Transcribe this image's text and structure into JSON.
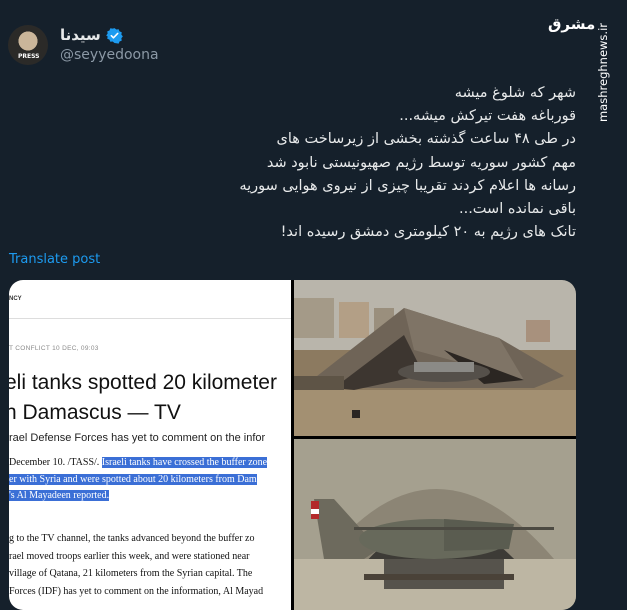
{
  "author": {
    "display_name": "سیدنا",
    "handle": "@seyyedoona",
    "avatar_badge": "PRESS"
  },
  "watermark": {
    "logo_text": "مشرق",
    "site": "mashreghnews.ir"
  },
  "tweet": {
    "text": "شهر که شلوغ میشه\nقورباغه هفت تیرکش میشه...\nدر طی ۴۸ ساعت گذشته بخشی از زیرساخت های\nمهم کشور سوریه توسط رژیم صهیونیستی نابود شد\nرسانه ها اعلام کردند تقریبا چیزی از نیروی هوایی سوریه\nباقی نمانده است...\nتانک های رژیم به ۲۰ کیلومتری دمشق رسیده اند!",
    "translate_label": "Translate post"
  },
  "media": {
    "article": {
      "brand_fragment": "NCY",
      "meta": "T CONFLICT   10 DEC, 09:03",
      "headline_line1": "eli tanks spotted 20 kilometer",
      "headline_line2": "n Damascus — TV",
      "subtitle": "rael Defense Forces has yet to comment on the infor",
      "body": {
        "l1_pre": "December 10. /TASS/. ",
        "l1_hl": "Israeli tanks have crossed the buffer zone",
        "l2_hl": "er with Syria and were spotted about 20 kilometers from Dam",
        "l3_hl": "'s Al Mayadeen",
        "l3_post": " reported.",
        "l4": "g to the TV channel, the tanks advanced beyond the buffer zo",
        "l5": "rael moved troops earlier this week, and were stationed near",
        "l6": "village of Qatana, 21 kilometers from the Syrian capital. The",
        "l7": "Forces (IDF) has yet to comment on the information, Al Mayad"
      }
    }
  },
  "colors": {
    "background": "#15202b",
    "text": "#e7e9ea",
    "secondary": "#8b98a5",
    "link": "#1d9bf0",
    "highlight": "#3b6fd6"
  }
}
